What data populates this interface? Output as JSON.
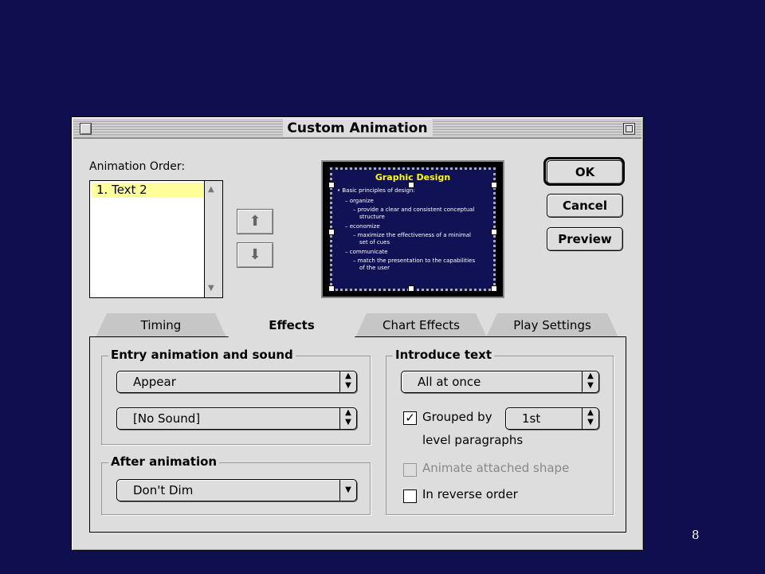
{
  "dialog": {
    "title": "Custom Animation",
    "animation_order_label": "Animation Order:",
    "animation_order_items": [
      "1. Text 2"
    ],
    "buttons": {
      "ok": "OK",
      "cancel": "Cancel",
      "preview": "Preview"
    }
  },
  "preview": {
    "title": "Graphic Design",
    "lines": [
      "• Basic principles of design:",
      "– organize",
      "– provide a clear and consistent conceptual",
      "structure",
      "– economize",
      "– maximize the effectiveness of a minimal",
      "set of cues",
      "– communicate",
      "– match the presentation to the capabilities",
      "of the user"
    ]
  },
  "tabs": [
    {
      "label": "Timing",
      "active": false
    },
    {
      "label": "Effects",
      "active": true
    },
    {
      "label": "Chart Effects",
      "active": false
    },
    {
      "label": "Play Settings",
      "active": false
    }
  ],
  "effects": {
    "entry_group": "Entry animation and sound",
    "entry_animation": "Appear",
    "entry_sound": "[No Sound]",
    "after_group": "After animation",
    "after_animation": "Don't Dim",
    "introduce_group": "Introduce text",
    "introduce_mode": "All at once",
    "grouped_by_label": "Grouped by",
    "grouped_by_value": "1st",
    "grouped_by_suffix": "level paragraphs",
    "grouped_checked": true,
    "animate_shape_label": "Animate attached shape",
    "animate_shape_checked": false,
    "reverse_label": "In reverse order",
    "reverse_checked": false
  },
  "slide": {
    "page_number": "8"
  }
}
